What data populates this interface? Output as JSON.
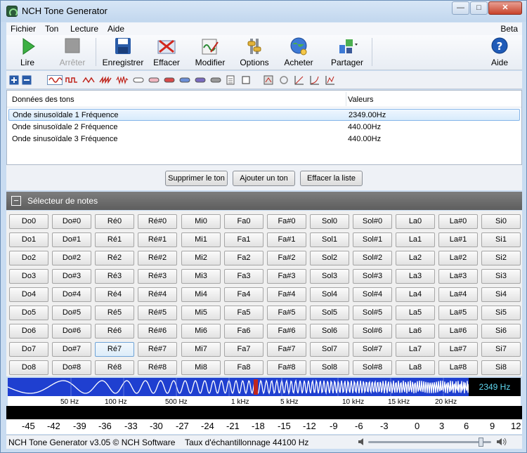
{
  "window": {
    "title": "NCH Tone Generator"
  },
  "menu": {
    "items": [
      "Fichier",
      "Ton",
      "Lecture",
      "Aide"
    ],
    "right": "Beta"
  },
  "toolbar": {
    "play": "Lire",
    "stop": "Arrêter",
    "save": "Enregistrer",
    "clear": "Effacer",
    "edit": "Modifier",
    "options": "Options",
    "buy": "Acheter",
    "share": "Partager",
    "help": "Aide"
  },
  "tone_list": {
    "col_data": "Données des tons",
    "col_values": "Valeurs",
    "rows": [
      {
        "name": "Onde sinusoïdale 1 Fréquence",
        "value": "2349.00Hz"
      },
      {
        "name": "Onde sinusoïdale 2 Fréquence",
        "value": "440.00Hz"
      },
      {
        "name": "Onde sinusoïdale 3 Fréquence",
        "value": "440.00Hz"
      }
    ]
  },
  "list_buttons": {
    "delete": "Supprimer le ton",
    "add": "Ajouter un ton",
    "clear": "Effacer la liste"
  },
  "note_selector": {
    "title": "Sélecteur de notes",
    "notes": [
      "Do",
      "Do#",
      "Ré",
      "Ré#",
      "Mi",
      "Fa",
      "Fa#",
      "Sol",
      "Sol#",
      "La",
      "La#",
      "Si"
    ],
    "octaves": [
      0,
      1,
      2,
      3,
      4,
      5,
      6,
      7,
      8
    ]
  },
  "spectrum": {
    "current_freq": "2349 Hz",
    "labels": [
      "50 Hz",
      "100 Hz",
      "500 Hz",
      "1 kHz",
      "5 kHz",
      "10 kHz",
      "15 kHz",
      "20 kHz"
    ]
  },
  "db_scale": [
    "-45",
    "-42",
    "-39",
    "-36",
    "-33",
    "-30",
    "-27",
    "-24",
    "-21",
    "-18",
    "-15",
    "-12",
    "-9",
    "-6",
    "-3",
    "0",
    "3",
    "6",
    "9",
    "12"
  ],
  "status": {
    "version": "NCH Tone Generator v3.05 © NCH Software",
    "sample_rate": "Taux d'échantillonnage 44100 Hz"
  },
  "colors": {
    "accent": "#1f3fd0",
    "freq_text": "#5fd7f0",
    "marker": "#c0261d"
  }
}
